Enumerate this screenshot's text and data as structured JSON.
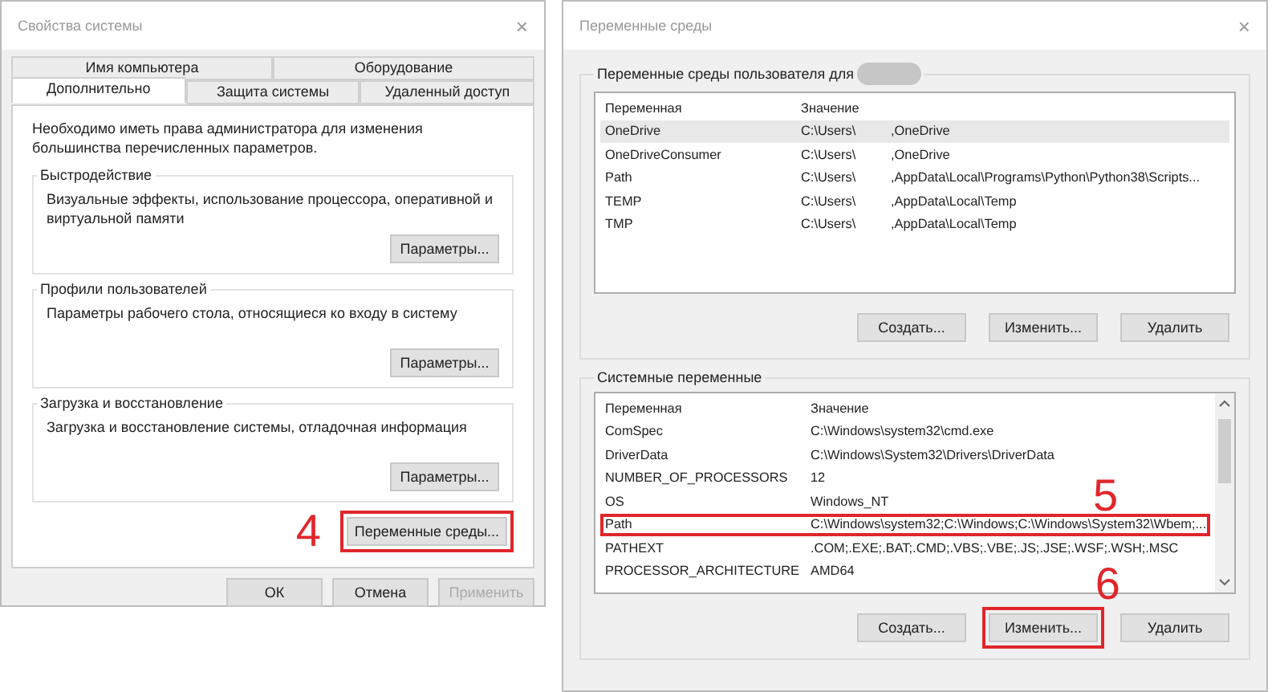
{
  "system_properties": {
    "title": "Свойства системы",
    "close": "×",
    "tab_rows": [
      [
        {
          "label": "Имя компьютера",
          "selected": false
        },
        {
          "label": "Оборудование",
          "selected": false
        }
      ],
      [
        {
          "label": "Дополнительно",
          "selected": true
        },
        {
          "label": "Защита системы",
          "selected": false
        },
        {
          "label": "Удаленный доступ",
          "selected": false
        }
      ]
    ],
    "notice": "Необходимо иметь права администратора для изменения большинства перечисленных параметров.",
    "groups": [
      {
        "title": "Быстродействие",
        "text": "Визуальные эффекты, использование процессора, оперативной и виртуальной памяти",
        "button": "Параметры..."
      },
      {
        "title": "Профили пользователей",
        "text": "Параметры рабочего стола, относящиеся ко входу в систему",
        "button": "Параметры..."
      },
      {
        "title": "Загрузка и восстановление",
        "text": "Загрузка и восстановление системы, отладочная информация",
        "button": "Параметры..."
      }
    ],
    "env_button": {
      "label": "Переменные среды...",
      "highlighted": true,
      "step": "4"
    },
    "buttons": [
      {
        "label": "ОК",
        "disabled": false
      },
      {
        "label": "Отмена",
        "disabled": false
      },
      {
        "label": "Применить",
        "disabled": true
      }
    ]
  },
  "environment_variables": {
    "title": "Переменные среды",
    "close": "×",
    "user_group": {
      "title": "Переменные среды пользователя для",
      "columns": [
        "Переменная",
        "Значение"
      ],
      "rows": [
        {
          "name": "OneDrive",
          "value": "C:\\Users\\",
          "value_2": ",OneDrive",
          "selected": true
        },
        {
          "name": "OneDriveConsumer",
          "value": "C:\\Users\\",
          "value_2": ",OneDrive",
          "selected": false
        },
        {
          "name": "Path",
          "value": "C:\\Users\\",
          "value_2": ",AppData\\Local\\Programs\\Python\\Python38\\Scripts...",
          "selected": false
        },
        {
          "name": "TEMP",
          "value": "C:\\Users\\",
          "value_2": ",AppData\\Local\\Temp",
          "selected": false
        },
        {
          "name": "TMP",
          "value": "C:\\Users\\",
          "value_2": ",AppData\\Local\\Temp",
          "selected": false
        }
      ],
      "buttons": [
        {
          "label": "Создать...",
          "highlighted": false
        },
        {
          "label": "Изменить...",
          "highlighted": false
        },
        {
          "label": "Удалить",
          "highlighted": false
        }
      ]
    },
    "system_group": {
      "title": "Системные переменные",
      "columns": [
        "Переменная",
        "Значение"
      ],
      "rows": [
        {
          "name": "ComSpec",
          "value": "C:\\Windows\\system32\\cmd.exe",
          "highlighted": false
        },
        {
          "name": "DriverData",
          "value": "C:\\Windows\\System32\\Drivers\\DriverData",
          "highlighted": false
        },
        {
          "name": "NUMBER_OF_PROCESSORS",
          "value": "12",
          "highlighted": false
        },
        {
          "name": "OS",
          "value": "Windows_NT",
          "highlighted": false
        },
        {
          "name": "Path",
          "value": "C:\\Windows\\system32;C:\\Windows;C:\\Windows\\System32\\Wbem;...",
          "highlighted": true,
          "step": "5"
        },
        {
          "name": "PATHEXT",
          "value": ".COM;.EXE;.BAT;.CMD;.VBS;.VBE;.JS;.JSE;.WSF;.WSH;.MSC",
          "highlighted": false
        },
        {
          "name": "PROCESSOR_ARCHITECTURE",
          "value": "AMD64",
          "highlighted": false
        }
      ],
      "buttons": [
        {
          "label": "Создать...",
          "highlighted": false
        },
        {
          "label": "Изменить...",
          "highlighted": true,
          "step": "6"
        },
        {
          "label": "Удалить",
          "highlighted": false
        }
      ]
    }
  }
}
